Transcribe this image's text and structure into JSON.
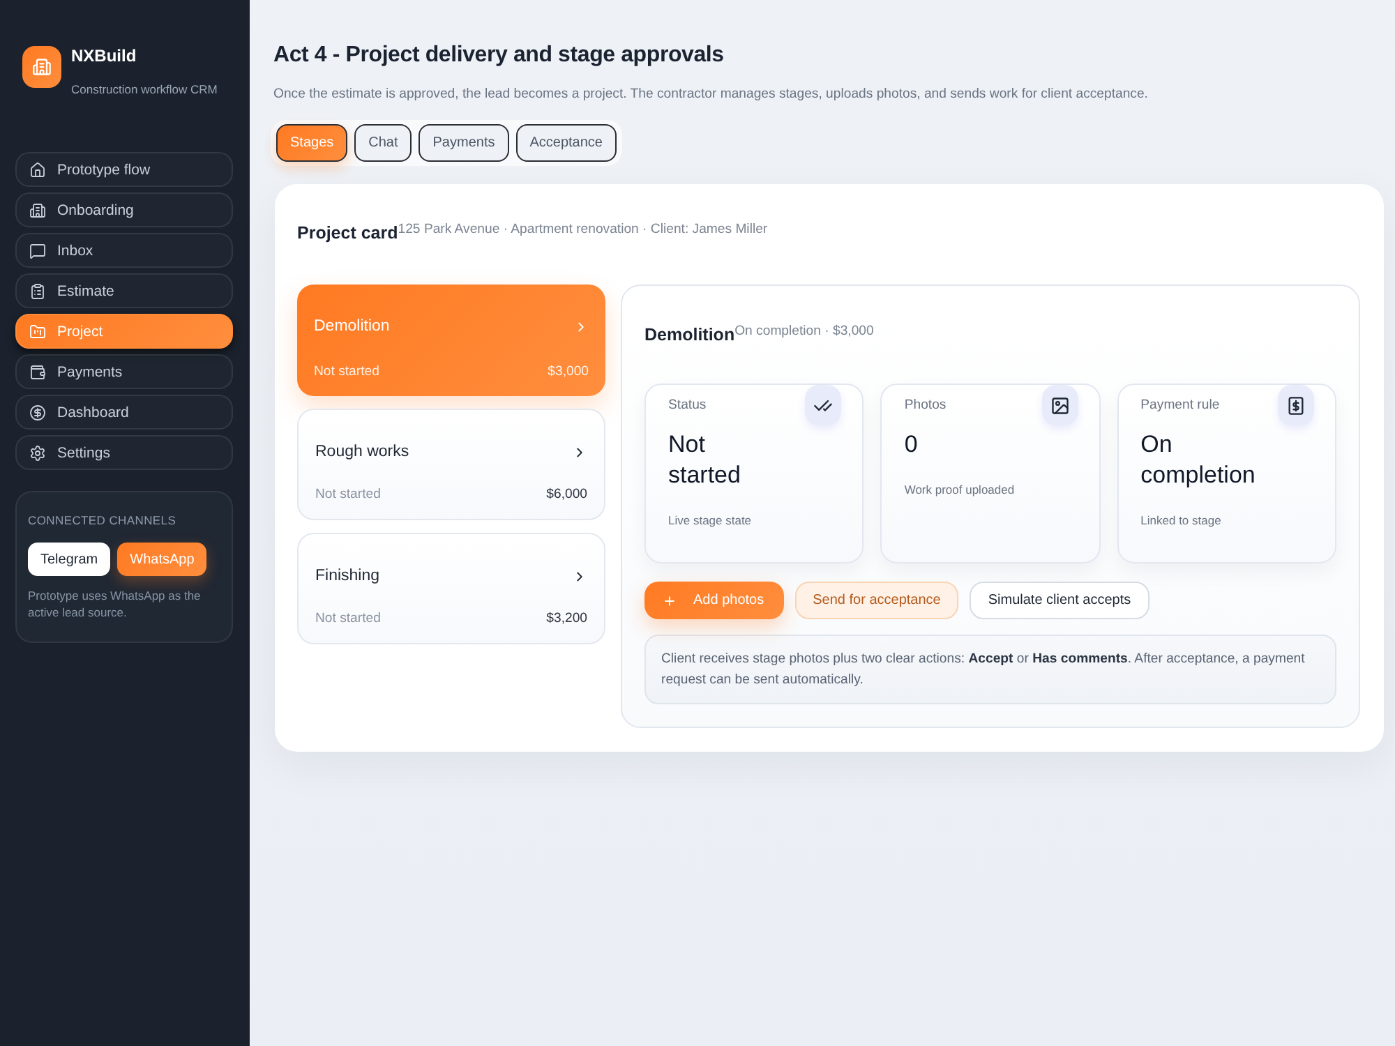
{
  "sidebar": {
    "brand": {
      "name": "NXBuild",
      "tagline": "Construction workflow CRM"
    },
    "nav": [
      {
        "label": "Prototype flow",
        "selected": false
      },
      {
        "label": "Onboarding",
        "selected": false
      },
      {
        "label": "Inbox",
        "selected": false
      },
      {
        "label": "Estimate",
        "selected": false
      },
      {
        "label": "Project",
        "selected": true
      },
      {
        "label": "Payments",
        "selected": false
      },
      {
        "label": "Dashboard",
        "selected": false
      },
      {
        "label": "Settings",
        "selected": false
      }
    ],
    "channels": {
      "title": "CONNECTED CHANNELS",
      "options": [
        {
          "label": "Telegram",
          "selected": false
        },
        {
          "label": "WhatsApp",
          "selected": true
        }
      ],
      "note": "Prototype uses WhatsApp as the active lead source."
    }
  },
  "header": {
    "title": "Act 4 - Project delivery and stage approvals",
    "description": "Once the estimate is approved, the lead becomes a project. The contractor manages stages, uploads photos, and sends work for client acceptance."
  },
  "tabs": [
    {
      "label": "Stages",
      "selected": true
    },
    {
      "label": "Chat",
      "selected": false
    },
    {
      "label": "Payments",
      "selected": false
    },
    {
      "label": "Acceptance",
      "selected": false
    }
  ],
  "project_card": {
    "title": "Project card",
    "meta": "125 Park Avenue · Apartment renovation · Client: James Miller",
    "stages": [
      {
        "name": "Demolition",
        "status": "Not started",
        "amount": "$3,000",
        "selected": true
      },
      {
        "name": "Rough works",
        "status": "Not started",
        "amount": "$6,000",
        "selected": false
      },
      {
        "name": "Finishing",
        "status": "Not started",
        "amount": "$3,200",
        "selected": false
      }
    ],
    "detail": {
      "title": "Demolition",
      "meta": "On completion · $3,000",
      "stats": [
        {
          "label": "Status",
          "value": "Not started",
          "note": "Live stage state"
        },
        {
          "label": "Photos",
          "value": "0",
          "note": "Work proof uploaded"
        },
        {
          "label": "Payment rule",
          "value": "On completion",
          "note": "Linked to stage"
        }
      ],
      "actions": [
        {
          "label": "Add photos",
          "kind": "primary"
        },
        {
          "label": "Send for acceptance",
          "kind": "soft"
        },
        {
          "label": "Simulate client accepts",
          "kind": "outline"
        }
      ],
      "info": "Client receives stage photos plus two clear actions: **Accept** or **Has comments**. After acceptance, a payment request can be sent automatically."
    }
  }
}
